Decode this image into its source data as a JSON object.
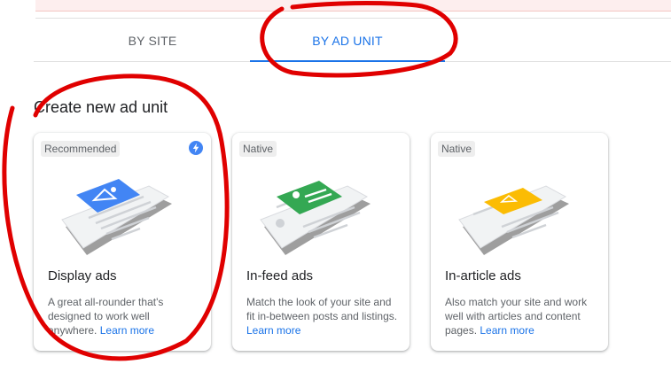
{
  "tabs": [
    {
      "label": "BY SITE",
      "selected": false
    },
    {
      "label": "BY AD UNIT",
      "selected": true
    }
  ],
  "section_title": "Create new ad unit",
  "cards": [
    {
      "badge": "Recommended",
      "badge_icon": "bolt-icon",
      "title": "Display ads",
      "description": "A great all-rounder that's designed to work well anywhere.",
      "link": "Learn more",
      "accent": "#4285f4"
    },
    {
      "badge": "Native",
      "title": "In-feed ads",
      "description": "Match the look of your site and fit in-between posts and listings.",
      "link": "Learn more",
      "accent": "#34a853"
    },
    {
      "badge": "Native",
      "title": "In-article ads",
      "description": "Also match your site and work well with articles and content pages.",
      "link": "Learn more",
      "accent": "#fbbc04"
    }
  ],
  "colors": {
    "primary": "#1a73e8",
    "annotation": "#e00000"
  }
}
